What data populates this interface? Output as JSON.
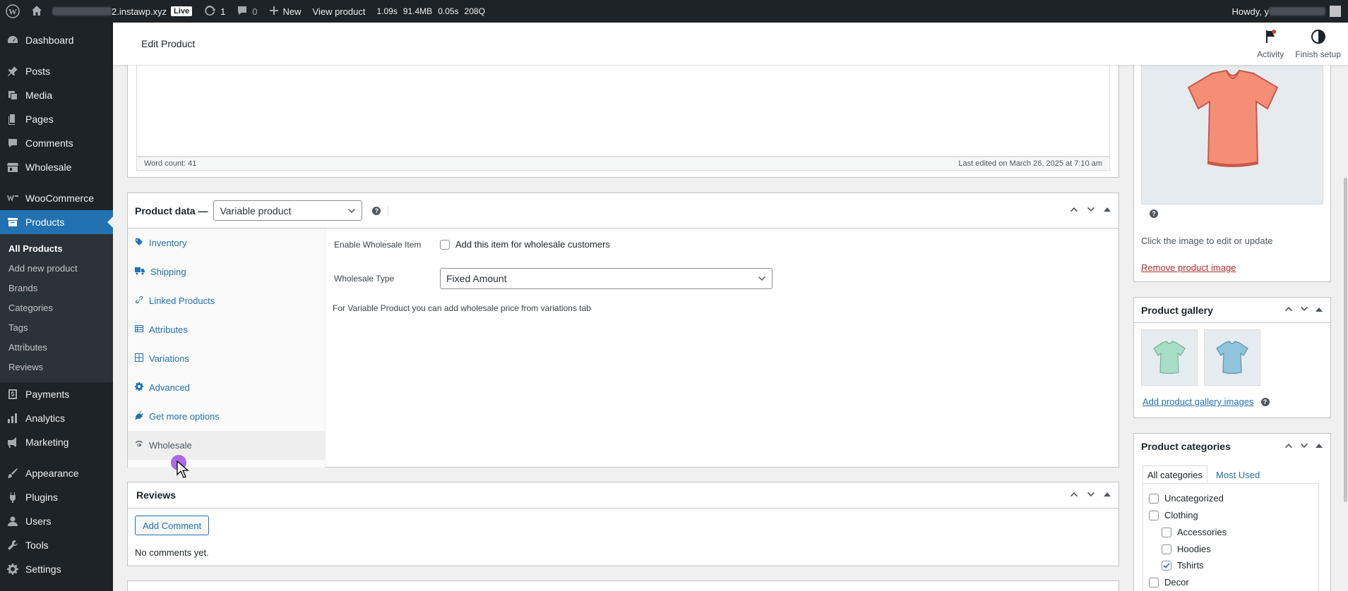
{
  "admin_bar": {
    "site_suffix": "2.instawp.xyz",
    "live_badge": "Live",
    "updates_count": "1",
    "comments_count": "0",
    "new_label": "New",
    "view_product": "View product",
    "perf_time": "1.09s",
    "perf_mem": "91.4MB",
    "perf_query_time": "0.05s",
    "perf_queries": "208Q",
    "howdy": "Howdy, y"
  },
  "sidebar": {
    "dashboard": "Dashboard",
    "posts": "Posts",
    "media": "Media",
    "pages": "Pages",
    "comments": "Comments",
    "wholesale": "Wholesale",
    "woocommerce": "WooCommerce",
    "products": "Products",
    "submenu": [
      "All Products",
      "Add new product",
      "Brands",
      "Categories",
      "Tags",
      "Attributes",
      "Reviews"
    ],
    "payments": "Payments",
    "analytics": "Analytics",
    "marketing": "Marketing",
    "appearance": "Appearance",
    "plugins": "Plugins",
    "users": "Users",
    "tools": "Tools",
    "settings": "Settings"
  },
  "header": {
    "title": "Edit Product",
    "activity": "Activity",
    "finish_setup": "Finish setup"
  },
  "editor": {
    "word_count": "Word count: 41",
    "last_edited": "Last edited on March 26, 2025 at 7:10 am"
  },
  "product_data": {
    "title": "Product data —",
    "type_selected": "Variable product",
    "tabs": [
      "Inventory",
      "Shipping",
      "Linked Products",
      "Attributes",
      "Variations",
      "Advanced",
      "Get more options",
      "Wholesale"
    ],
    "enable_label": "Enable Wholesale Item",
    "enable_checkbox_label": "Add this item for wholesale customers",
    "type_label": "Wholesale Type",
    "type_value": "Fixed Amount",
    "note": "For Variable Product you can add wholesale price from variations tab"
  },
  "reviews": {
    "title": "Reviews",
    "add_comment": "Add Comment",
    "empty": "No comments yet."
  },
  "product_image": {
    "hint": "Click the image to edit or update",
    "remove": "Remove product image"
  },
  "gallery": {
    "title": "Product gallery",
    "add_link": "Add product gallery images"
  },
  "categories": {
    "title": "Product categories",
    "tab_all": "All categories",
    "tab_most_used": "Most Used",
    "items": [
      {
        "label": "Uncategorized",
        "checked": false
      },
      {
        "label": "Clothing",
        "checked": false
      },
      {
        "label": "Accessories",
        "checked": false
      },
      {
        "label": "Hoodies",
        "checked": false
      },
      {
        "label": "Tshirts",
        "checked": true
      },
      {
        "label": "Decor",
        "checked": false
      }
    ]
  },
  "colors": {
    "admin_dark": "#1d2327",
    "accent": "#2271b1",
    "danger": "#b32d2e",
    "cursor": "#9b51e0"
  }
}
